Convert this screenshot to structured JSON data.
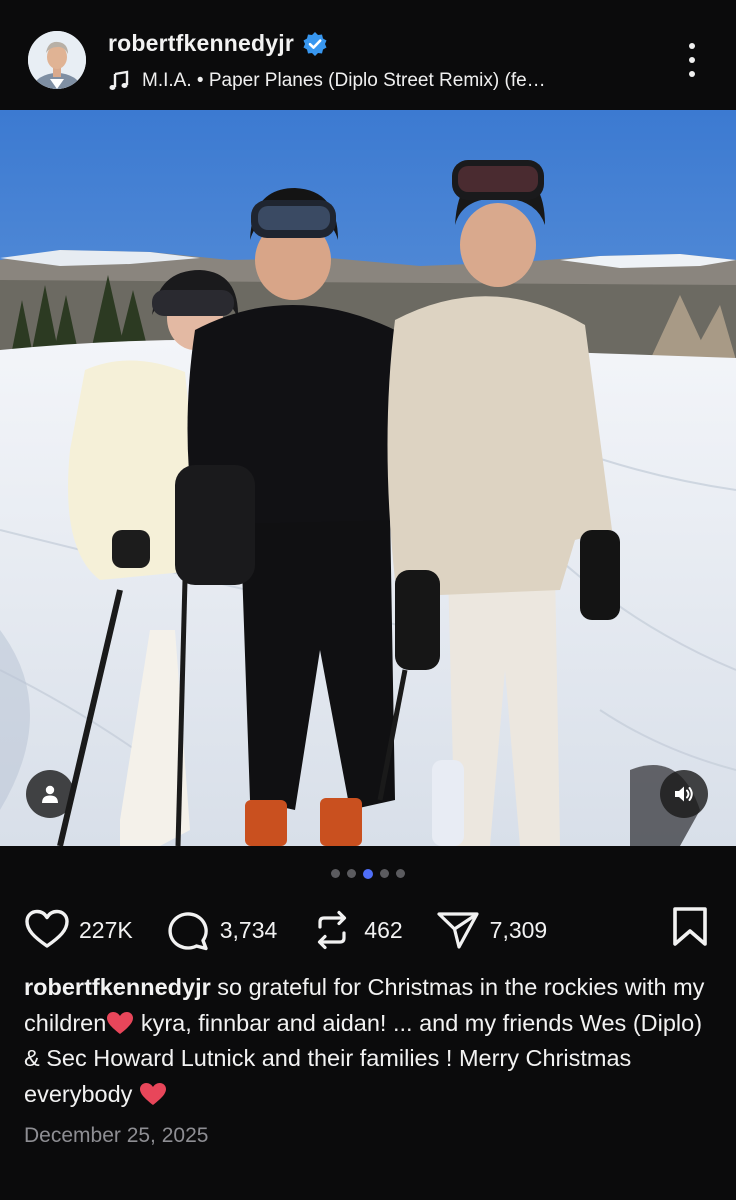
{
  "header": {
    "username": "robertfkennedyjr",
    "verified": true,
    "music_track": "M.I.A. • Paper Planes (Diplo Street Remix) (fe…",
    "avatar_icon": "profile-photo",
    "more_icon": "more-vertical-icon"
  },
  "photo": {
    "carousel_index": 3,
    "carousel_total": 5,
    "tag_icon": "person-icon",
    "sound_icon": "speaker-icon"
  },
  "actions": {
    "likes": "227K",
    "comments": "3,734",
    "reposts": "462",
    "shares": "7,309"
  },
  "caption": {
    "username": "robertfkennedyjr",
    "part1": " so grateful for Christmas in the rockies with my children",
    "part2": " kyra, finnbar and aidan! ... and my friends Wes (Diplo) & Sec Howard Lutnick and their families ! Merry Christmas everybody ",
    "emoji": "red-heart"
  },
  "date": "December 25, 2025",
  "colors": {
    "background": "#0b0b0c",
    "accent_dot": "#4f6ef7",
    "verified_blue": "#3897f0",
    "heart_emoji": "#e8465a"
  }
}
